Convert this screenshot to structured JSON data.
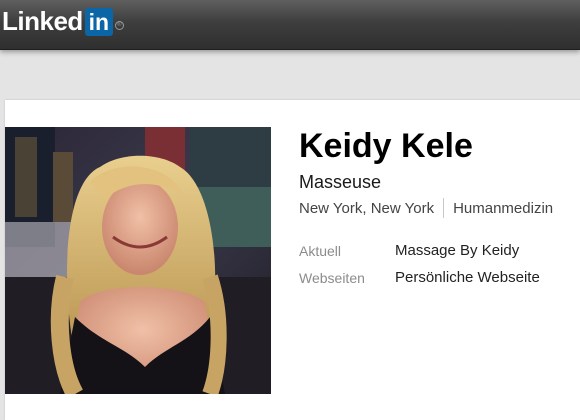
{
  "header": {
    "logo_text": "Linked",
    "logo_box": "in",
    "logo_reg": "®"
  },
  "profile": {
    "name": "Keidy Kele",
    "headline": "Masseuse",
    "location": "New York, New York",
    "industry": "Humanmedizin",
    "details": [
      {
        "label": "Aktuell",
        "value": "Massage By Keidy"
      },
      {
        "label": "Webseiten",
        "value": "Persönliche Webseite"
      }
    ]
  },
  "colors": {
    "topbar": "#3e3e3e",
    "brand_blue": "#0a66a6",
    "page_bg": "#e4e4e4",
    "card_bg": "#ffffff"
  }
}
